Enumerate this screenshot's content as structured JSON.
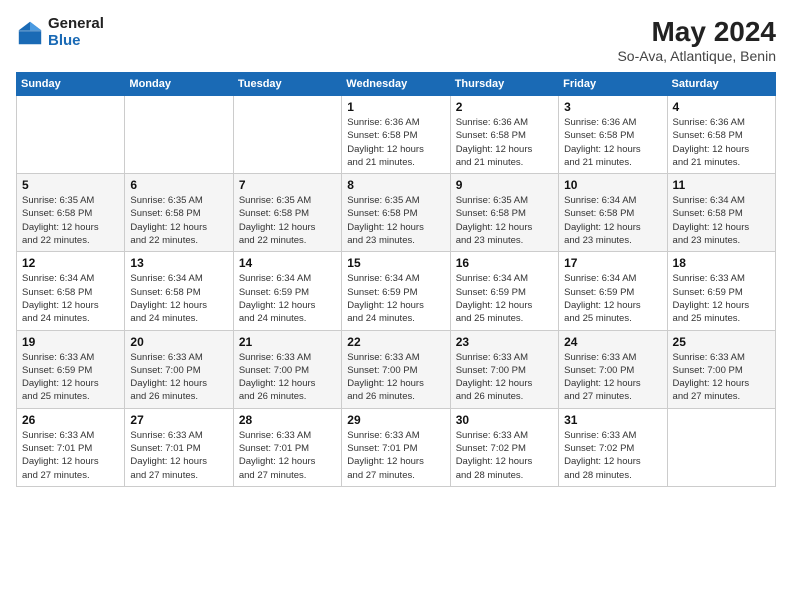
{
  "header": {
    "logo_line1": "General",
    "logo_line2": "Blue",
    "title": "May 2024",
    "subtitle": "So-Ava, Atlantique, Benin"
  },
  "days_of_week": [
    "Sunday",
    "Monday",
    "Tuesday",
    "Wednesday",
    "Thursday",
    "Friday",
    "Saturday"
  ],
  "weeks": [
    [
      {
        "day": "",
        "info": ""
      },
      {
        "day": "",
        "info": ""
      },
      {
        "day": "",
        "info": ""
      },
      {
        "day": "1",
        "info": "Sunrise: 6:36 AM\nSunset: 6:58 PM\nDaylight: 12 hours\nand 21 minutes."
      },
      {
        "day": "2",
        "info": "Sunrise: 6:36 AM\nSunset: 6:58 PM\nDaylight: 12 hours\nand 21 minutes."
      },
      {
        "day": "3",
        "info": "Sunrise: 6:36 AM\nSunset: 6:58 PM\nDaylight: 12 hours\nand 21 minutes."
      },
      {
        "day": "4",
        "info": "Sunrise: 6:36 AM\nSunset: 6:58 PM\nDaylight: 12 hours\nand 21 minutes."
      }
    ],
    [
      {
        "day": "5",
        "info": "Sunrise: 6:35 AM\nSunset: 6:58 PM\nDaylight: 12 hours\nand 22 minutes."
      },
      {
        "day": "6",
        "info": "Sunrise: 6:35 AM\nSunset: 6:58 PM\nDaylight: 12 hours\nand 22 minutes."
      },
      {
        "day": "7",
        "info": "Sunrise: 6:35 AM\nSunset: 6:58 PM\nDaylight: 12 hours\nand 22 minutes."
      },
      {
        "day": "8",
        "info": "Sunrise: 6:35 AM\nSunset: 6:58 PM\nDaylight: 12 hours\nand 23 minutes."
      },
      {
        "day": "9",
        "info": "Sunrise: 6:35 AM\nSunset: 6:58 PM\nDaylight: 12 hours\nand 23 minutes."
      },
      {
        "day": "10",
        "info": "Sunrise: 6:34 AM\nSunset: 6:58 PM\nDaylight: 12 hours\nand 23 minutes."
      },
      {
        "day": "11",
        "info": "Sunrise: 6:34 AM\nSunset: 6:58 PM\nDaylight: 12 hours\nand 23 minutes."
      }
    ],
    [
      {
        "day": "12",
        "info": "Sunrise: 6:34 AM\nSunset: 6:58 PM\nDaylight: 12 hours\nand 24 minutes."
      },
      {
        "day": "13",
        "info": "Sunrise: 6:34 AM\nSunset: 6:58 PM\nDaylight: 12 hours\nand 24 minutes."
      },
      {
        "day": "14",
        "info": "Sunrise: 6:34 AM\nSunset: 6:59 PM\nDaylight: 12 hours\nand 24 minutes."
      },
      {
        "day": "15",
        "info": "Sunrise: 6:34 AM\nSunset: 6:59 PM\nDaylight: 12 hours\nand 24 minutes."
      },
      {
        "day": "16",
        "info": "Sunrise: 6:34 AM\nSunset: 6:59 PM\nDaylight: 12 hours\nand 25 minutes."
      },
      {
        "day": "17",
        "info": "Sunrise: 6:34 AM\nSunset: 6:59 PM\nDaylight: 12 hours\nand 25 minutes."
      },
      {
        "day": "18",
        "info": "Sunrise: 6:33 AM\nSunset: 6:59 PM\nDaylight: 12 hours\nand 25 minutes."
      }
    ],
    [
      {
        "day": "19",
        "info": "Sunrise: 6:33 AM\nSunset: 6:59 PM\nDaylight: 12 hours\nand 25 minutes."
      },
      {
        "day": "20",
        "info": "Sunrise: 6:33 AM\nSunset: 7:00 PM\nDaylight: 12 hours\nand 26 minutes."
      },
      {
        "day": "21",
        "info": "Sunrise: 6:33 AM\nSunset: 7:00 PM\nDaylight: 12 hours\nand 26 minutes."
      },
      {
        "day": "22",
        "info": "Sunrise: 6:33 AM\nSunset: 7:00 PM\nDaylight: 12 hours\nand 26 minutes."
      },
      {
        "day": "23",
        "info": "Sunrise: 6:33 AM\nSunset: 7:00 PM\nDaylight: 12 hours\nand 26 minutes."
      },
      {
        "day": "24",
        "info": "Sunrise: 6:33 AM\nSunset: 7:00 PM\nDaylight: 12 hours\nand 27 minutes."
      },
      {
        "day": "25",
        "info": "Sunrise: 6:33 AM\nSunset: 7:00 PM\nDaylight: 12 hours\nand 27 minutes."
      }
    ],
    [
      {
        "day": "26",
        "info": "Sunrise: 6:33 AM\nSunset: 7:01 PM\nDaylight: 12 hours\nand 27 minutes."
      },
      {
        "day": "27",
        "info": "Sunrise: 6:33 AM\nSunset: 7:01 PM\nDaylight: 12 hours\nand 27 minutes."
      },
      {
        "day": "28",
        "info": "Sunrise: 6:33 AM\nSunset: 7:01 PM\nDaylight: 12 hours\nand 27 minutes."
      },
      {
        "day": "29",
        "info": "Sunrise: 6:33 AM\nSunset: 7:01 PM\nDaylight: 12 hours\nand 27 minutes."
      },
      {
        "day": "30",
        "info": "Sunrise: 6:33 AM\nSunset: 7:02 PM\nDaylight: 12 hours\nand 28 minutes."
      },
      {
        "day": "31",
        "info": "Sunrise: 6:33 AM\nSunset: 7:02 PM\nDaylight: 12 hours\nand 28 minutes."
      },
      {
        "day": "",
        "info": ""
      }
    ]
  ]
}
